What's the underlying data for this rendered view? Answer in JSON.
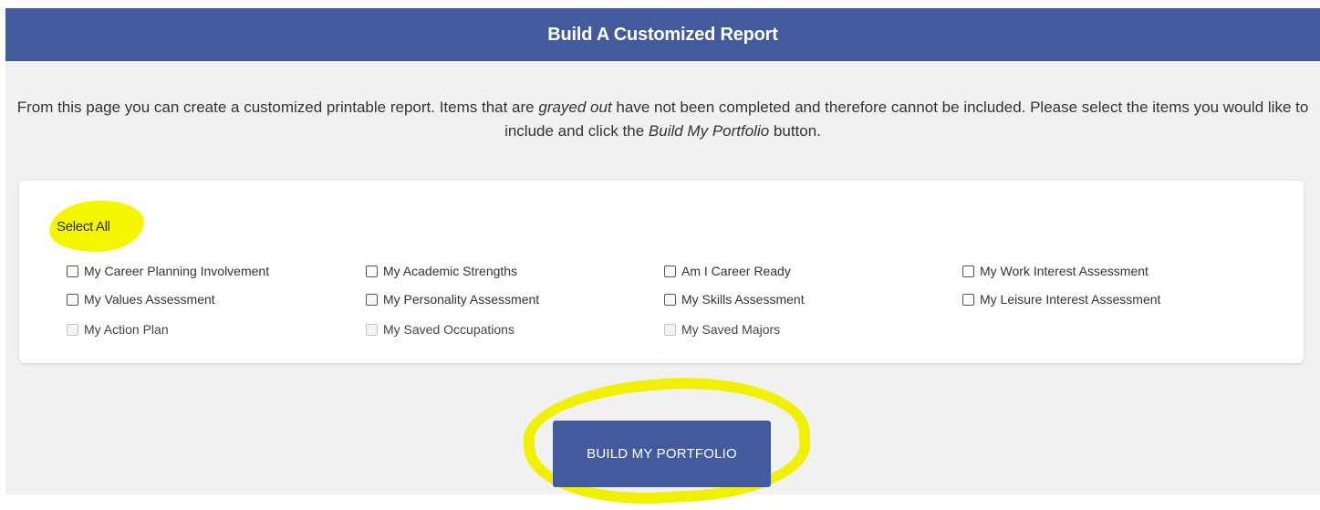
{
  "header": {
    "title": "Build A Customized Report"
  },
  "intro": {
    "part1": "From this page you can create a customized printable report. Items that are ",
    "em1": "grayed out",
    "part2": " have not been completed and therefore cannot be included. Please select the items you would like to include and click the ",
    "em2": "Build My Portfolio",
    "part3": " button."
  },
  "options": {
    "select_all_label": "Select All",
    "items": [
      {
        "label": "My Career Planning Involvement",
        "enabled": true,
        "checked": false
      },
      {
        "label": "My Academic Strengths",
        "enabled": true,
        "checked": false
      },
      {
        "label": "Am I Career Ready",
        "enabled": true,
        "checked": false
      },
      {
        "label": "My Work Interest Assessment",
        "enabled": true,
        "checked": false
      },
      {
        "label": "My Values Assessment",
        "enabled": true,
        "checked": false
      },
      {
        "label": "My Personality Assessment",
        "enabled": true,
        "checked": false
      },
      {
        "label": "My Skills Assessment",
        "enabled": true,
        "checked": false
      },
      {
        "label": "My Leisure Interest Assessment",
        "enabled": true,
        "checked": false
      },
      {
        "label": "My Action Plan",
        "enabled": false,
        "checked": false
      },
      {
        "label": "My Saved Occupations",
        "enabled": false,
        "checked": false
      },
      {
        "label": "My Saved Majors",
        "enabled": false,
        "checked": false
      }
    ]
  },
  "build_button": {
    "label": "BUILD MY PORTFOLIO"
  },
  "colors": {
    "header": "#435b9d",
    "page_background": "#f1f1f1",
    "annotation_highlight": "#f5f500"
  }
}
